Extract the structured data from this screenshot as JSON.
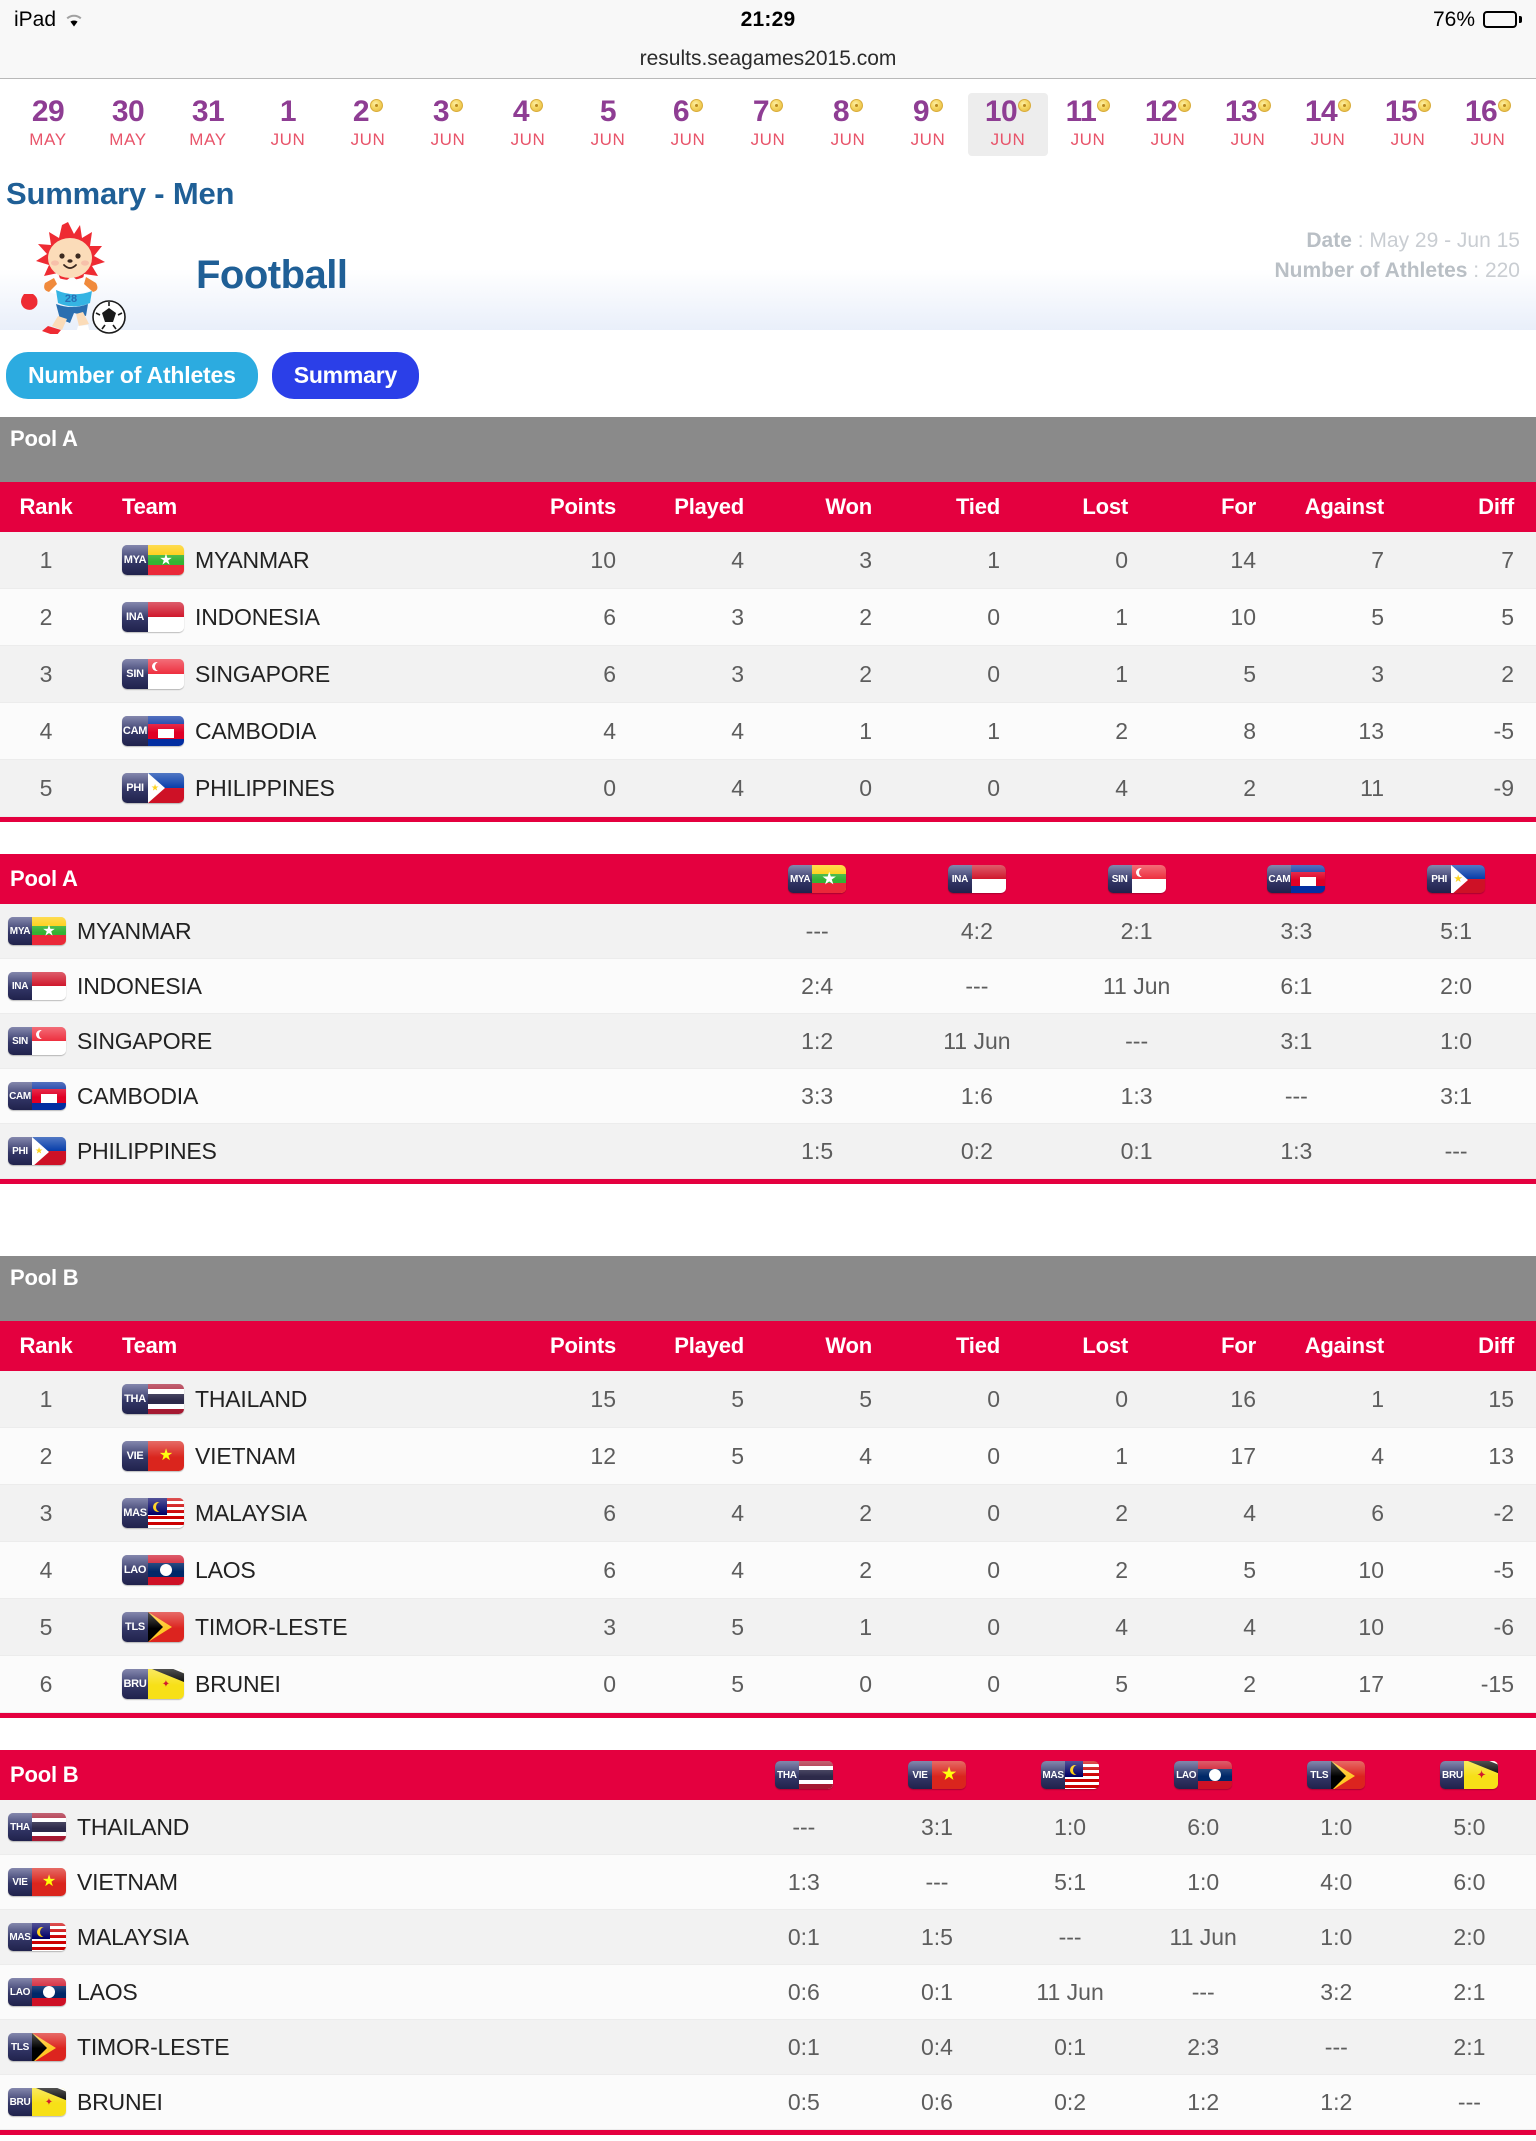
{
  "status_bar": {
    "device": "iPad",
    "wifi_icon": "wifi-icon",
    "time": "21:29",
    "battery_percent": "76%",
    "battery_icon": "battery-icon"
  },
  "browser": {
    "url": "results.seagames2015.com"
  },
  "date_strip": {
    "dates": [
      {
        "day": "29",
        "month": "MAY",
        "medal": false,
        "active": false
      },
      {
        "day": "30",
        "month": "MAY",
        "medal": false,
        "active": false
      },
      {
        "day": "31",
        "month": "MAY",
        "medal": false,
        "active": false
      },
      {
        "day": "1",
        "month": "JUN",
        "medal": false,
        "active": false
      },
      {
        "day": "2",
        "month": "JUN",
        "medal": true,
        "active": false
      },
      {
        "day": "3",
        "month": "JUN",
        "medal": true,
        "active": false
      },
      {
        "day": "4",
        "month": "JUN",
        "medal": true,
        "active": false
      },
      {
        "day": "5",
        "month": "JUN",
        "medal": false,
        "active": false
      },
      {
        "day": "6",
        "month": "JUN",
        "medal": true,
        "active": false
      },
      {
        "day": "7",
        "month": "JUN",
        "medal": true,
        "active": false
      },
      {
        "day": "8",
        "month": "JUN",
        "medal": true,
        "active": false
      },
      {
        "day": "9",
        "month": "JUN",
        "medal": true,
        "active": false
      },
      {
        "day": "10",
        "month": "JUN",
        "medal": true,
        "active": true
      },
      {
        "day": "11",
        "month": "JUN",
        "medal": true,
        "active": false
      },
      {
        "day": "12",
        "month": "JUN",
        "medal": true,
        "active": false
      },
      {
        "day": "13",
        "month": "JUN",
        "medal": true,
        "active": false
      },
      {
        "day": "14",
        "month": "JUN",
        "medal": true,
        "active": false
      },
      {
        "day": "15",
        "month": "JUN",
        "medal": true,
        "active": false
      },
      {
        "day": "16",
        "month": "JUN",
        "medal": true,
        "active": false
      }
    ]
  },
  "page": {
    "title": "Summary - Men",
    "sport": "Football",
    "mascot_icon": "mascot-nila-icon",
    "date_label": "Date",
    "date_value": "May 29 - Jun 15",
    "athletes_label": "Number of Athletes",
    "athletes_value": "220"
  },
  "tabs": {
    "number_of_athletes": "Number of Athletes",
    "summary": "Summary"
  },
  "colors": {
    "accent_red": "#e4003f",
    "pool_gray": "#8a8a8a",
    "title_blue": "#1f5f96",
    "date_purple": "#8e3d93",
    "month_pink": "#e8546a",
    "cyan_button": "#2cabe0",
    "blue_button": "#2b3fe8"
  },
  "standings": [
    {
      "pool": "Pool A",
      "columns": [
        "Rank",
        "Team",
        "Points",
        "Played",
        "Won",
        "Tied",
        "Lost",
        "For",
        "Against",
        "Diff"
      ],
      "rows": [
        {
          "rank": "1",
          "code": "MYA",
          "team": "MYANMAR",
          "points": "10",
          "played": "4",
          "won": "3",
          "tied": "1",
          "lost": "0",
          "for": "14",
          "against": "7",
          "diff": "7"
        },
        {
          "rank": "2",
          "code": "INA",
          "team": "INDONESIA",
          "points": "6",
          "played": "3",
          "won": "2",
          "tied": "0",
          "lost": "1",
          "for": "10",
          "against": "5",
          "diff": "5"
        },
        {
          "rank": "3",
          "code": "SIN",
          "team": "SINGAPORE",
          "points": "6",
          "played": "3",
          "won": "2",
          "tied": "0",
          "lost": "1",
          "for": "5",
          "against": "3",
          "diff": "2"
        },
        {
          "rank": "4",
          "code": "CAM",
          "team": "CAMBODIA",
          "points": "4",
          "played": "4",
          "won": "1",
          "tied": "1",
          "lost": "2",
          "for": "8",
          "against": "13",
          "diff": "-5"
        },
        {
          "rank": "5",
          "code": "PHI",
          "team": "PHILIPPINES",
          "points": "0",
          "played": "4",
          "won": "0",
          "tied": "0",
          "lost": "4",
          "for": "2",
          "against": "11",
          "diff": "-9"
        }
      ]
    },
    {
      "pool": "Pool B",
      "columns": [
        "Rank",
        "Team",
        "Points",
        "Played",
        "Won",
        "Tied",
        "Lost",
        "For",
        "Against",
        "Diff"
      ],
      "rows": [
        {
          "rank": "1",
          "code": "THA",
          "team": "THAILAND",
          "points": "15",
          "played": "5",
          "won": "5",
          "tied": "0",
          "lost": "0",
          "for": "16",
          "against": "1",
          "diff": "15"
        },
        {
          "rank": "2",
          "code": "VIE",
          "team": "VIETNAM",
          "points": "12",
          "played": "5",
          "won": "4",
          "tied": "0",
          "lost": "1",
          "for": "17",
          "against": "4",
          "diff": "13"
        },
        {
          "rank": "3",
          "code": "MAS",
          "team": "MALAYSIA",
          "points": "6",
          "played": "4",
          "won": "2",
          "tied": "0",
          "lost": "2",
          "for": "4",
          "against": "6",
          "diff": "-2"
        },
        {
          "rank": "4",
          "code": "LAO",
          "team": "LAOS",
          "points": "6",
          "played": "4",
          "won": "2",
          "tied": "0",
          "lost": "2",
          "for": "5",
          "against": "10",
          "diff": "-5"
        },
        {
          "rank": "5",
          "code": "TLS",
          "team": "TIMOR-LESTE",
          "points": "3",
          "played": "5",
          "won": "1",
          "tied": "0",
          "lost": "4",
          "for": "4",
          "against": "10",
          "diff": "-6"
        },
        {
          "rank": "6",
          "code": "BRU",
          "team": "BRUNEI",
          "points": "0",
          "played": "5",
          "won": "0",
          "tied": "0",
          "lost": "5",
          "for": "2",
          "against": "17",
          "diff": "-15"
        }
      ]
    }
  ],
  "matrices": [
    {
      "pool": "Pool A",
      "column_codes": [
        "MYA",
        "INA",
        "SIN",
        "CAM",
        "PHI"
      ],
      "rows": [
        {
          "code": "MYA",
          "team": "MYANMAR",
          "scores": [
            "---",
            "4:2",
            "2:1",
            "3:3",
            "5:1"
          ]
        },
        {
          "code": "INA",
          "team": "INDONESIA",
          "scores": [
            "2:4",
            "---",
            "11 Jun",
            "6:1",
            "2:0"
          ]
        },
        {
          "code": "SIN",
          "team": "SINGAPORE",
          "scores": [
            "1:2",
            "11 Jun",
            "---",
            "3:1",
            "1:0"
          ]
        },
        {
          "code": "CAM",
          "team": "CAMBODIA",
          "scores": [
            "3:3",
            "1:6",
            "1:3",
            "---",
            "3:1"
          ]
        },
        {
          "code": "PHI",
          "team": "PHILIPPINES",
          "scores": [
            "1:5",
            "0:2",
            "0:1",
            "1:3",
            "---"
          ]
        }
      ]
    },
    {
      "pool": "Pool B",
      "column_codes": [
        "THA",
        "VIE",
        "MAS",
        "LAO",
        "TLS",
        "BRU"
      ],
      "rows": [
        {
          "code": "THA",
          "team": "THAILAND",
          "scores": [
            "---",
            "3:1",
            "1:0",
            "6:0",
            "1:0",
            "5:0"
          ]
        },
        {
          "code": "VIE",
          "team": "VIETNAM",
          "scores": [
            "1:3",
            "---",
            "5:1",
            "1:0",
            "4:0",
            "6:0"
          ]
        },
        {
          "code": "MAS",
          "team": "MALAYSIA",
          "scores": [
            "0:1",
            "1:5",
            "---",
            "11 Jun",
            "1:0",
            "2:0"
          ]
        },
        {
          "code": "LAO",
          "team": "LAOS",
          "scores": [
            "0:6",
            "0:1",
            "11 Jun",
            "---",
            "3:2",
            "2:1"
          ]
        },
        {
          "code": "TLS",
          "team": "TIMOR-LESTE",
          "scores": [
            "0:1",
            "0:4",
            "0:1",
            "2:3",
            "---",
            "2:1"
          ]
        },
        {
          "code": "BRU",
          "team": "BRUNEI",
          "scores": [
            "0:5",
            "0:6",
            "0:2",
            "1:2",
            "1:2",
            "---"
          ]
        }
      ]
    }
  ]
}
